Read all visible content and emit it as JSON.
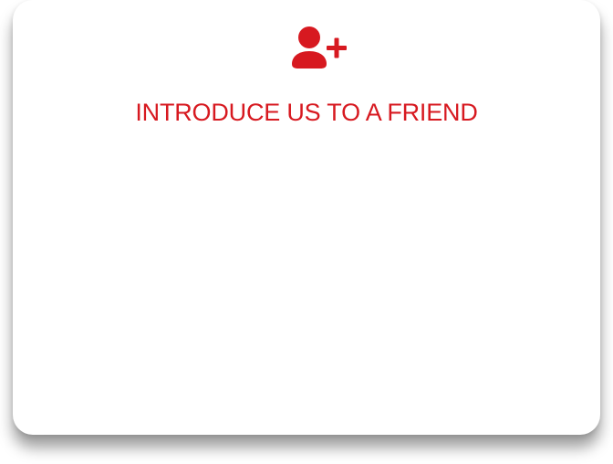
{
  "card": {
    "icon": "add-user-icon",
    "title": "INTRODUCE US TO A FRIEND"
  },
  "colors": {
    "accent": "#d71920",
    "card_background": "#ffffff"
  }
}
